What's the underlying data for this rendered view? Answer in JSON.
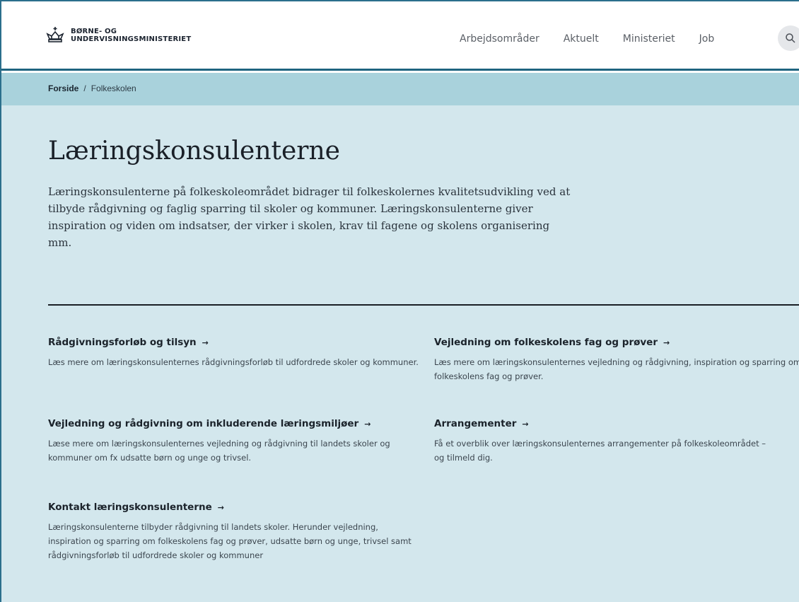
{
  "header": {
    "logo_line1": "BØRNE- OG",
    "logo_line2": "UNDERVISNINGSMINISTERIET",
    "nav": [
      "Arbejdsområder",
      "Aktuelt",
      "Ministeriet",
      "Job"
    ],
    "search_icon": "search-icon"
  },
  "breadcrumb": {
    "home": "Forside",
    "separator": "/",
    "current": "Folkeskolen"
  },
  "page": {
    "title": "Læringskonsulenterne",
    "lead": "Læringskonsulenterne på folkeskoleområdet bidrager til folkeskolernes kvalitetsudvikling ved at tilbyde rådgivning og faglig sparring til skoler og kommuner. Læringskonsulenterne giver inspiration og viden om indsatser, der virker i skolen, krav til fagene og skolens organisering mm."
  },
  "cards": [
    {
      "title": "Rådgivningsforløb og tilsyn",
      "desc": "Læs mere om læringskonsulenternes rådgivningsforløb til udfordrede skoler og kommuner."
    },
    {
      "title": "Vejledning om folkeskolens fag og prøver",
      "desc": "Læs mere om læringskonsulenternes vejledning og rådgivning, inspiration og sparring om folkeskolens fag og prøver."
    },
    {
      "title": "Vejledning og rådgivning om inkluderende læringsmiljøer",
      "desc": "Læse mere om læringskonsulenternes vejledning og rådgivning til landets skoler og kommuner om fx udsatte børn og unge og trivsel."
    },
    {
      "title": "Arrangementer",
      "desc": "Få et overblik over læringskonsulenternes arrangementer på folkeskoleområdet – og tilmeld dig."
    },
    {
      "title": "Kontakt læringskonsulenterne",
      "desc": "Læringskonsulenterne tilbyder rådgivning til landets skoler. Herunder vejledning, inspiration og sparring om folkeskolens fag og prøver, udsatte børn og unge, trivsel samt rådgivningsforløb til udfordrede skoler og kommuner"
    }
  ],
  "arrow_glyph": "→",
  "colors": {
    "header_border": "#1f6480",
    "breadcrumb_bg": "#a9d2dc",
    "main_bg": "#d3e7ed"
  }
}
